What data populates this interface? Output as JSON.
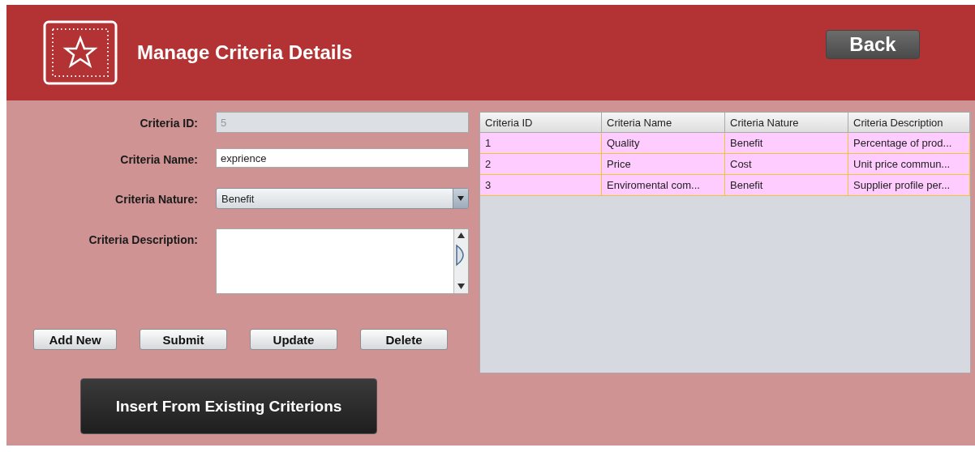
{
  "header": {
    "title": "Manage Criteria Details",
    "back_button": "Back"
  },
  "form": {
    "fields": [
      {
        "kind": "text",
        "label": "Criteria ID:",
        "value": "5",
        "disabled": true
      },
      {
        "kind": "text",
        "label": "Criteria Name:",
        "value": "exprience",
        "disabled": false
      },
      {
        "kind": "select",
        "label": "Criteria Nature:",
        "value": "Benefit",
        "disabled": false
      },
      {
        "kind": "textarea",
        "label": "Criteria Description:",
        "disabled": false
      }
    ],
    "buttons": [
      "Add New",
      "Submit",
      "Update",
      "Delete"
    ],
    "insert_button": "Insert From Existing Criterions"
  },
  "table": {
    "columns": [
      "Criteria ID",
      "Criteria Name",
      "Criteria Nature",
      "Criteria Description"
    ],
    "rows": [
      [
        "1",
        "Quality",
        "Benefit",
        "Percentage of prod..."
      ],
      [
        "2",
        "Price",
        "Cost",
        "Unit price commun..."
      ],
      [
        "3",
        "Enviromental com...",
        "Benefit",
        "Supplier profile per..."
      ]
    ]
  }
}
